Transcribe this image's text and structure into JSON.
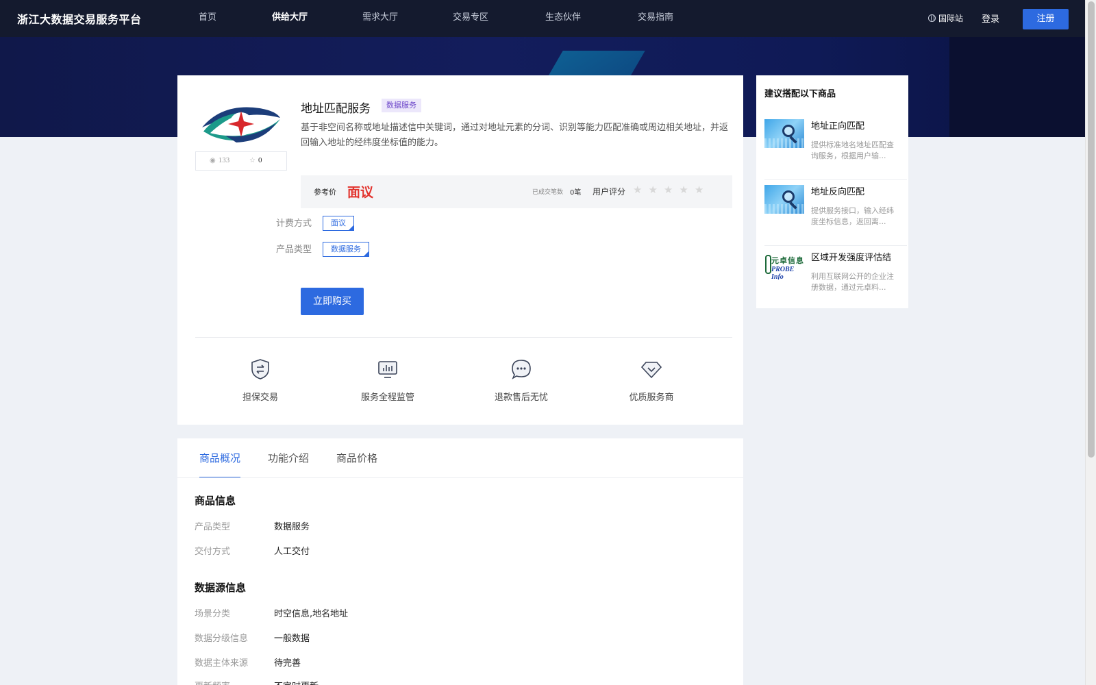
{
  "header": {
    "brand": "浙江大数据交易服务平台",
    "nav": [
      "首页",
      "供给大厅",
      "需求大厅",
      "交易专区",
      "生态伙伴",
      "交易指南"
    ],
    "active_nav": "供给大厅",
    "intl_label": "国际站",
    "login_label": "登录",
    "register_label": "注册"
  },
  "product": {
    "title": "地址匹配服务",
    "tag": "数据服务",
    "description": "基于非空间名称或地址描述信中关键词，通过对地址元素的分词、识别等能力匹配准确或周边相关地址，并返回输入地址的经纬度坐标值的能力。",
    "views": "133",
    "favorites": "0",
    "price_label": "参考价",
    "price_value": "面议",
    "deal_label": "已成交笔数",
    "deal_value": "0笔",
    "rating_label": "用户评分",
    "rating": 0,
    "rating_max": 5,
    "billing_label": "计费方式",
    "billing_value": "面议",
    "type_label": "产品类型",
    "type_value": "数据服务",
    "buy_label": "立即购买"
  },
  "guarantees": [
    {
      "label": "担保交易",
      "icon": "shield-exchange-icon"
    },
    {
      "label": "服务全程监管",
      "icon": "monitor-chart-icon"
    },
    {
      "label": "退款售后无忧",
      "icon": "chat-bubble-icon"
    },
    {
      "label": "优质服务商",
      "icon": "diamond-icon"
    }
  ],
  "sidebar": {
    "title": "建议搭配以下商品",
    "items": [
      {
        "name": "地址正向匹配",
        "desc": "提供标准地名地址匹配查询服务，根据用户输..."
      },
      {
        "name": "地址反向匹配",
        "desc": "提供服务接口，输入经纬度坐标信息，返回离..."
      },
      {
        "name": "区域开发强度评估结",
        "desc": "利用互联网公开的企业注册数据，通过元卓料...",
        "thumb_text_1": "元卓信息",
        "thumb_text_2": "PROBE Info"
      }
    ]
  },
  "tabs": [
    "商品概况",
    "功能介绍",
    "商品价格"
  ],
  "active_tab": "商品概况",
  "overview": {
    "product_info_title": "商品信息",
    "product_info": [
      {
        "label": "产品类型",
        "value": "数据服务"
      },
      {
        "label": "交付方式",
        "value": "人工交付"
      }
    ],
    "source_info_title": "数据源信息",
    "source_info": [
      {
        "label": "场景分类",
        "value": "时空信息,地名地址"
      },
      {
        "label": "数据分级信息",
        "value": "一般数据"
      },
      {
        "label": "数据主体来源",
        "value": "待完善"
      },
      {
        "label": "更新频率",
        "value": "不定时更新"
      }
    ]
  },
  "colors": {
    "accent": "#2d6ae0",
    "price": "#e2342e",
    "header_bg": "#141a2e",
    "banner_bg": "#131d5c",
    "tag_bg": "#ece7fb",
    "tag_text": "#6b45c9"
  }
}
